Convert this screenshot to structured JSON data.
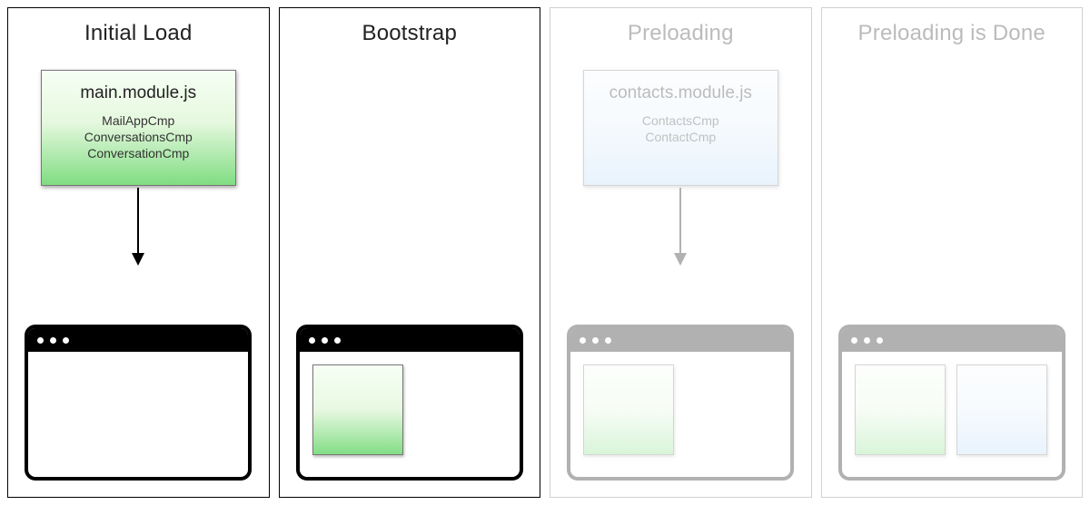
{
  "panels": [
    {
      "title": "Initial Load",
      "faded": false,
      "module": {
        "name": "main.module.js",
        "color": "green",
        "components": [
          "MailAppCmp",
          "ConversationsCmp",
          "ConversationCmp"
        ]
      },
      "arrow": true,
      "browser_tiles": []
    },
    {
      "title": "Bootstrap",
      "faded": false,
      "module": null,
      "arrow": false,
      "browser_tiles": [
        "green"
      ]
    },
    {
      "title": "Preloading",
      "faded": true,
      "module": {
        "name": "contacts.module.js",
        "color": "blue",
        "components": [
          "ContactsCmp",
          "ContactCmp"
        ]
      },
      "arrow": true,
      "browser_tiles": [
        "green"
      ]
    },
    {
      "title": "Preloading is Done",
      "faded": true,
      "module": null,
      "arrow": false,
      "browser_tiles": [
        "green",
        "blue"
      ]
    }
  ]
}
